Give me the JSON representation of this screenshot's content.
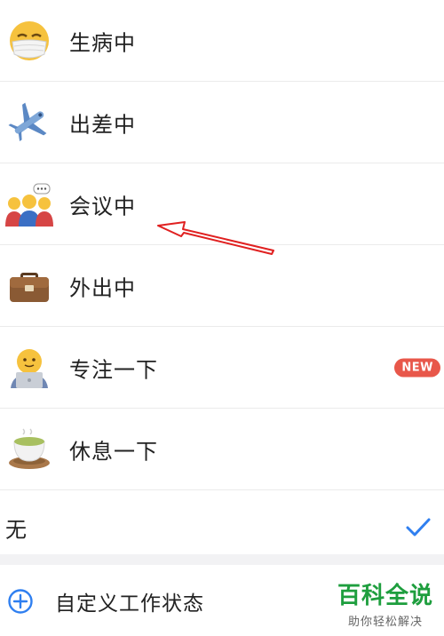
{
  "status_options": [
    {
      "label": "生病中",
      "icon": "mask-face-icon"
    },
    {
      "label": "出差中",
      "icon": "airplane-icon"
    },
    {
      "label": "会议中",
      "icon": "meeting-people-icon"
    },
    {
      "label": "外出中",
      "icon": "briefcase-icon"
    },
    {
      "label": "专注一下",
      "icon": "laptop-person-icon",
      "badge": "NEW"
    },
    {
      "label": "休息一下",
      "icon": "tea-cup-icon"
    }
  ],
  "none_option": {
    "label": "无",
    "selected": true
  },
  "custom_status": {
    "label": "自定义工作状态",
    "icon": "plus-circle-icon"
  },
  "watermark": {
    "title": "百科全说",
    "subtitle": "助你轻松解决"
  },
  "colors": {
    "accent": "#2f7ff0",
    "badge": "#e8574a",
    "watermark": "#1e9e3e",
    "arrow": "#e02020"
  }
}
